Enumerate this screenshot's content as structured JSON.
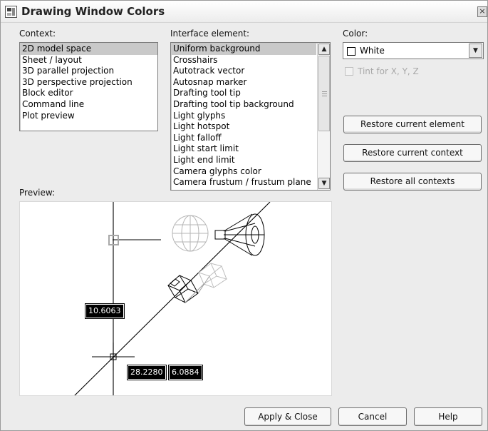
{
  "window": {
    "title": "Drawing Window Colors",
    "close_label": "×"
  },
  "context": {
    "label": "Context:",
    "items": [
      "2D model space",
      "Sheet / layout",
      "3D parallel projection",
      "3D perspective projection",
      "Block editor",
      "Command line",
      "Plot preview"
    ],
    "selected": "2D model space"
  },
  "interface_element": {
    "label": "Interface element:",
    "items": [
      "Uniform background",
      "Crosshairs",
      "Autotrack vector",
      "Autosnap marker",
      "Drafting tool tip",
      "Drafting tool tip background",
      "Light glyphs",
      "Light hotspot",
      "Light falloff",
      "Light start limit",
      "Light end limit",
      "Camera glyphs color",
      "Camera frustum / frustum plane"
    ],
    "selected": "Uniform background"
  },
  "color": {
    "label": "Color:",
    "value": "White",
    "swatch_color": "#ffffff"
  },
  "tint": {
    "label": "Tint for X, Y, Z",
    "checked": false,
    "enabled": false
  },
  "buttons": {
    "restore_element": "Restore current element",
    "restore_context": "Restore current context",
    "restore_all": "Restore all contexts",
    "apply_close": "Apply & Close",
    "cancel": "Cancel",
    "help": "Help"
  },
  "preview": {
    "label": "Preview:",
    "tooltip_vertical": "10.6063",
    "tooltip_x": "28.2280",
    "tooltip_y": "6.0884"
  },
  "icons": {
    "title": "drawing-window-icon",
    "scroll_up": "▲",
    "scroll_down": "▼",
    "dropdown": "▼"
  }
}
